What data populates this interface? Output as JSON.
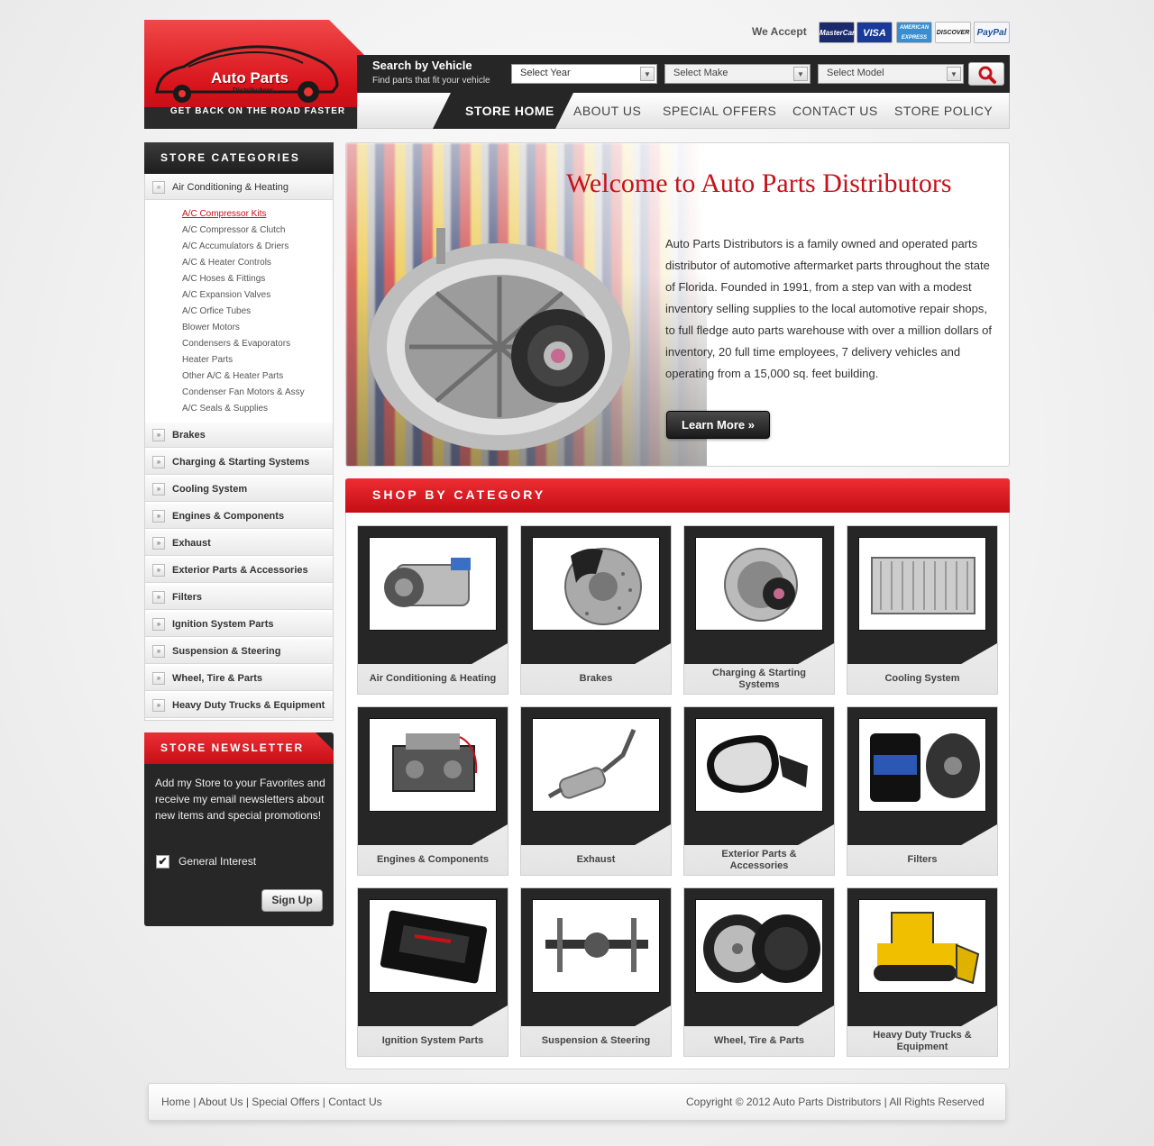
{
  "header": {
    "logo_title": "Auto Parts",
    "logo_subtitle": "Distributors",
    "logo_tagline": "GET BACK ON THE ROAD FASTER",
    "we_accept": "We Accept",
    "cards": [
      "MasterCard",
      "VISA",
      "AMERICAN EXPRESS",
      "DISCOVER",
      "PayPal"
    ]
  },
  "search": {
    "title": "Search by Vehicle",
    "subtitle": "Find parts that fit your vehicle",
    "year": "Select Year",
    "make": "Select Make",
    "model": "Select Model",
    "search_icon": "magnifier-icon"
  },
  "nav": [
    "STORE HOME",
    "ABOUT US",
    "SPECIAL OFFERS",
    "CONTACT US",
    "STORE POLICY"
  ],
  "sidebar": {
    "heading": "STORE CATEGORIES",
    "open_category": "Air Conditioning & Heating",
    "subcategories": [
      "A/C Compressor Kits",
      "A/C Compressor & Clutch",
      "A/C Accumulators & Driers",
      "A/C & Heater Controls",
      "A/C Hoses & Fittings",
      "A/C Expansion Valves",
      "A/C Orfice Tubes",
      "Blower Motors",
      "Condensers & Evaporators",
      "Heater Parts",
      "Other A/C & Heater Parts",
      "Condenser Fan Motors & Assy",
      "A/C Seals & Supplies"
    ],
    "categories": [
      "Brakes",
      "Charging & Starting Systems",
      "Cooling System",
      "Engines & Components",
      "Exhaust",
      "Exterior Parts & Accessories",
      "Filters",
      "Ignition System Parts",
      "Suspension & Steering",
      "Wheel, Tire & Parts",
      "Heavy Duty Trucks & Equipment"
    ]
  },
  "newsletter": {
    "heading": "STORE NEWSLETTER",
    "text": "Add my Store to your Favorites and receive my email newsletters about new items and special promotions!",
    "checkbox_label": "General Interest",
    "checkbox_checked": true,
    "button": "Sign Up"
  },
  "hero": {
    "title": "Welcome to Auto Parts Distributors",
    "text": "Auto Parts Distributors is a family owned and operated parts distributor of automotive aftermarket parts throughout the state of Florida. Founded in 1991, from a step van with a modest inventory selling supplies to the local automotive repair shops, to full fledge auto parts warehouse with over a million dollars of inventory, 20 full time employees, 7 delivery vehicles and operating from a 15,000 sq. feet building.",
    "button": "Learn More »"
  },
  "shop": {
    "heading": "SHOP BY CATEGORY",
    "tiles": [
      {
        "label": "Air Conditioning & Heating",
        "icon": "ac-compressor-icon"
      },
      {
        "label": "Brakes",
        "icon": "brake-disc-icon"
      },
      {
        "label": "Charging & Starting Systems",
        "icon": "alternator-icon"
      },
      {
        "label": "Cooling System",
        "icon": "radiator-icon"
      },
      {
        "label": "Engines & Components",
        "icon": "engine-icon"
      },
      {
        "label": "Exhaust",
        "icon": "muffler-icon"
      },
      {
        "label": "Exterior Parts & Accessories",
        "icon": "side-mirror-icon"
      },
      {
        "label": "Filters",
        "icon": "oil-filter-icon"
      },
      {
        "label": "Ignition System Parts",
        "icon": "ignition-box-icon"
      },
      {
        "label": "Suspension & Steering",
        "icon": "suspension-icon"
      },
      {
        "label": "Wheel, Tire & Parts",
        "icon": "wheel-tire-icon"
      },
      {
        "label": "Heavy Duty Trucks & Equipment",
        "icon": "bulldozer-icon"
      }
    ]
  },
  "footer": {
    "links": [
      "Home",
      "About Us",
      "Special Offers",
      "Contact Us"
    ],
    "copyright": "Copyright © 2012  Auto Parts Distributors | All Rights Reserved"
  },
  "colors": {
    "accent": "#c8101a",
    "dark": "#262626"
  }
}
